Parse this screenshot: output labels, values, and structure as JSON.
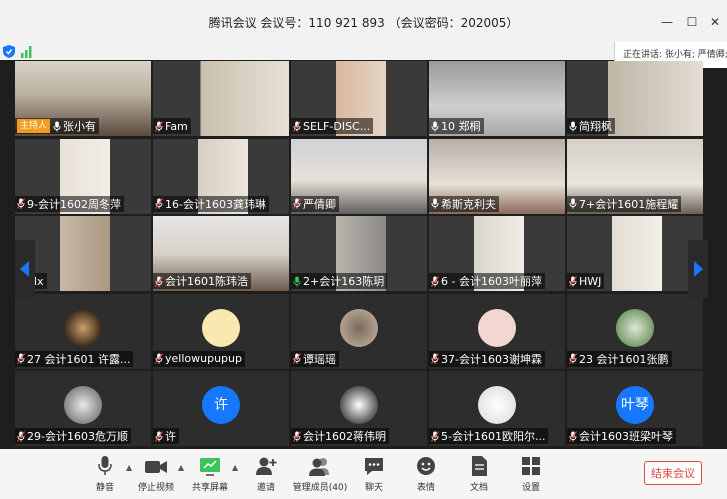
{
  "window": {
    "title": "腾讯会议 会议号：110 921 893 （会议密码：202005）",
    "speaking": "正在讲话: 张小有; 严倩卿;"
  },
  "host_badge": "主持人",
  "participants": [
    {
      "name": "张小有",
      "host": true
    },
    {
      "name": "Fam"
    },
    {
      "name": "SELF-DISC..."
    },
    {
      "name": "10 郑桐"
    },
    {
      "name": "简翔枫"
    },
    {
      "name": "9-会计1602周冬萍"
    },
    {
      "name": "16-会计1603龚玮琳"
    },
    {
      "name": "严倩卿"
    },
    {
      "name": "希斯克利夫"
    },
    {
      "name": "7+会计1601施程耀"
    },
    {
      "name": "dlx"
    },
    {
      "name": "会计1601陈玮浩"
    },
    {
      "name": "2+会计163陈玥"
    },
    {
      "name": "6 - 会计1603叶丽萍"
    },
    {
      "name": "HWJ"
    },
    {
      "name": "27 会计1601 许露..."
    },
    {
      "name": "yellowupupup"
    },
    {
      "name": "谭瑶瑶"
    },
    {
      "name": "37-会计1603谢坤霖"
    },
    {
      "name": "23 会计1601张鹏"
    },
    {
      "name": "29-会计1603危万顺"
    },
    {
      "name": "许",
      "avatar_text": "许"
    },
    {
      "name": "会计1602蒋伟明"
    },
    {
      "name": "5-会计1601欧阳尔..."
    },
    {
      "name": "会计1603班梁叶琴",
      "avatar_text": "叶琴"
    }
  ],
  "toolbar": {
    "mute": "静音",
    "stop_video": "停止视频",
    "share": "共享屏幕",
    "invite": "邀请",
    "manage": "管理成员(40)",
    "chat": "聊天",
    "emoji": "表情",
    "docs": "文档",
    "settings": "设置",
    "end": "结束会议"
  },
  "colors": {
    "accent_blue": "#1677ff",
    "host_orange": "#f29b1f",
    "end_red": "#e0483c",
    "active_mic_green": "#3cc45a"
  }
}
